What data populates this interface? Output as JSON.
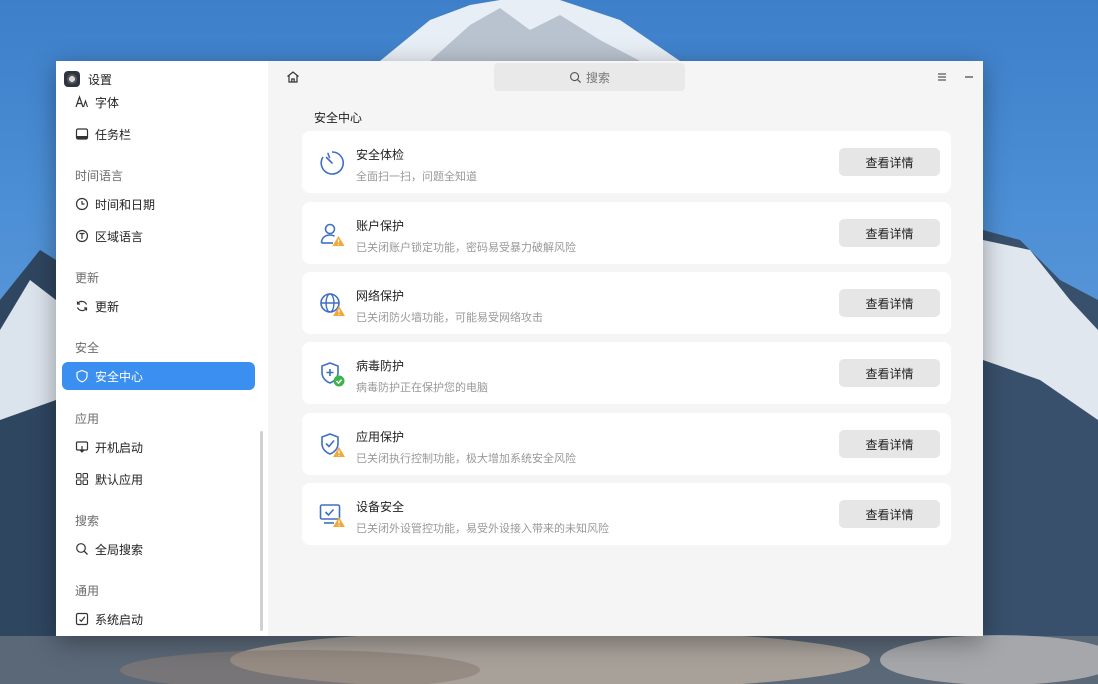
{
  "app": {
    "title": "设置"
  },
  "search": {
    "placeholder": "搜索"
  },
  "sidebar": {
    "items": [
      {
        "label": "字体",
        "icon": "font-icon"
      },
      {
        "label": "任务栏",
        "icon": "taskbar-icon"
      },
      {
        "section": "时间语言"
      },
      {
        "label": "时间和日期",
        "icon": "clock-icon"
      },
      {
        "label": "区域语言",
        "icon": "language-icon"
      },
      {
        "section": "更新"
      },
      {
        "label": "更新",
        "icon": "refresh-icon"
      },
      {
        "section": "安全"
      },
      {
        "label": "安全中心",
        "icon": "shield-icon",
        "active": true
      },
      {
        "section": "应用"
      },
      {
        "label": "开机启动",
        "icon": "startup-icon"
      },
      {
        "label": "默认应用",
        "icon": "apps-grid-icon"
      },
      {
        "section": "搜索"
      },
      {
        "label": "全局搜索",
        "icon": "search-icon"
      },
      {
        "section": "通用"
      },
      {
        "label": "系统启动",
        "icon": "boot-icon"
      }
    ]
  },
  "main": {
    "heading": "安全中心",
    "button_label": "查看详情",
    "cards": [
      {
        "title": "安全体检",
        "desc": "全面扫一扫，问题全知道",
        "icon": "scan-icon",
        "status": "none"
      },
      {
        "title": "账户保护",
        "desc": "已关闭账户锁定功能，密码易受暴力破解风险",
        "icon": "user-warning-icon",
        "status": "warning"
      },
      {
        "title": "网络保护",
        "desc": "已关闭防火墙功能，可能易受网络攻击",
        "icon": "globe-warning-icon",
        "status": "warning"
      },
      {
        "title": "病毒防护",
        "desc": "病毒防护正在保护您的电脑",
        "icon": "shield-check-icon",
        "status": "ok"
      },
      {
        "title": "应用保护",
        "desc": "已关闭执行控制功能，极大增加系统安全风险",
        "icon": "app-shield-warning-icon",
        "status": "warning"
      },
      {
        "title": "设备安全",
        "desc": "已关闭外设管控功能，易受外设接入带来的未知风险",
        "icon": "monitor-warning-icon",
        "status": "warning"
      }
    ]
  },
  "colors": {
    "accent": "#3b8ff0",
    "warning": "#f2a93b",
    "ok": "#3cb44b",
    "icon_stroke": "#3f6fc4"
  }
}
